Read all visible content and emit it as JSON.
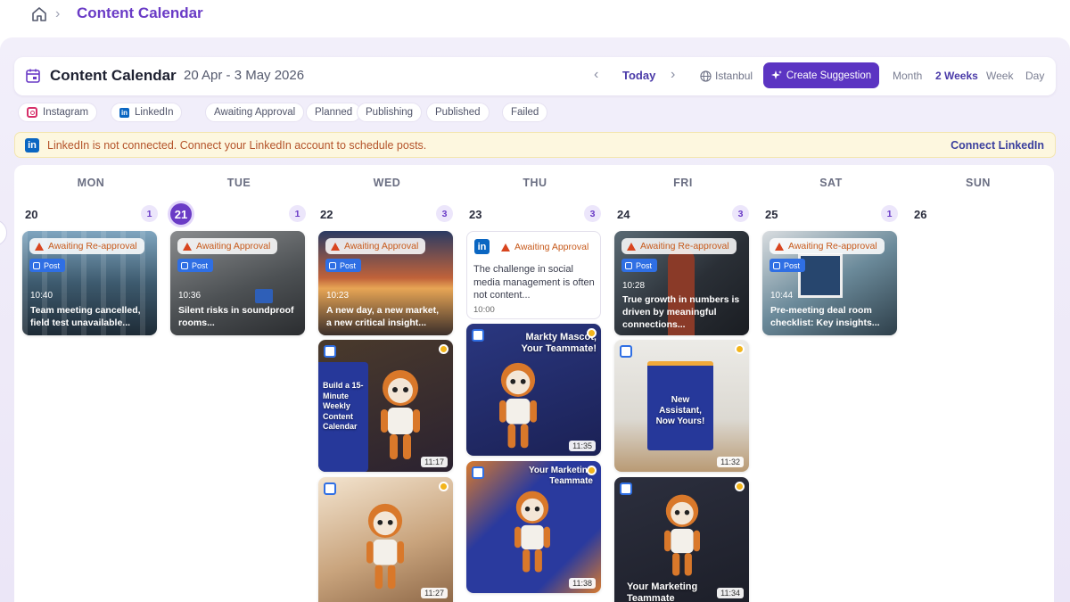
{
  "breadcrumb": {
    "home_icon": "home-icon",
    "title": "Content Calendar"
  },
  "header": {
    "title": "Content Calendar",
    "range": "20 Apr - 3 May 2026",
    "today": "Today",
    "timezone": "Istanbul",
    "create_button": "Create Suggestion",
    "views": [
      "Month",
      "2 Weeks",
      "Week",
      "Day"
    ],
    "active_view": "2 Weeks"
  },
  "filters": {
    "channels": [
      "Instagram",
      "LinkedIn"
    ],
    "statuses": [
      "Awaiting Approval",
      "Planned",
      "Publishing",
      "Published",
      "Failed"
    ]
  },
  "banner": {
    "text": "LinkedIn is not connected. Connect your LinkedIn account to schedule posts.",
    "link": "Connect LinkedIn"
  },
  "days": [
    {
      "dow": "MON",
      "num": "20",
      "count": "1"
    },
    {
      "dow": "TUE",
      "num": "21",
      "count": "1",
      "today": true
    },
    {
      "dow": "WED",
      "num": "22",
      "count": "3"
    },
    {
      "dow": "THU",
      "num": "23",
      "count": "3"
    },
    {
      "dow": "FRI",
      "num": "24",
      "count": "3"
    },
    {
      "dow": "SAT",
      "num": "25",
      "count": "1"
    },
    {
      "dow": "SUN",
      "num": "26",
      "count": ""
    }
  ],
  "posts": {
    "mon": {
      "status": "Awaiting Re-approval",
      "tag": "Post",
      "time": "10:40",
      "text": "Team meeting cancelled, field test unavailable..."
    },
    "tue": {
      "status": "Awaiting Approval",
      "tag": "Post",
      "time": "10:36",
      "text": "Silent risks in soundproof rooms..."
    },
    "wed1": {
      "status": "Awaiting Approval",
      "tag": "Post",
      "time": "10:23",
      "text": "A new day, a new market, a new critical insight..."
    },
    "thu1": {
      "status": "Awaiting Approval",
      "text": "The challenge in social media management is often not content...",
      "time": "10:00"
    },
    "fri1": {
      "status": "Awaiting Re-approval",
      "tag": "Post",
      "time": "10:28",
      "text": "True growth in numbers is driven by meaningful connections..."
    },
    "sat": {
      "status": "Awaiting Re-approval",
      "tag": "Post",
      "time": "10:44",
      "text": "Pre-meeting deal room checklist: Key insights..."
    },
    "wed2": {
      "time": "11:17",
      "img_text": "Build a 15-Minute Weekly Content Calendar"
    },
    "thu2": {
      "time": "11:35",
      "img_text": "Markty Mascot, Your Teammate!"
    },
    "fri2": {
      "time": "11:32",
      "img_text": "New Assistant, Now Yours!"
    },
    "wed3": {
      "time": "11:27"
    },
    "thu3": {
      "time": "11:38",
      "img_text": "Your Marketing Teammate"
    },
    "fri3": {
      "time": "11:34",
      "img_text": "Your Marketing Teammate"
    }
  },
  "colors": {
    "accent": "#5b34c2",
    "warning": "#c75a1c",
    "linkedin": "#0a66c2",
    "post_tag": "#2f6fe4"
  }
}
